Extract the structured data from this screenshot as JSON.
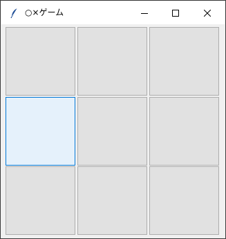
{
  "window": {
    "title": "○×ゲーム",
    "icon": "feather-icon",
    "controls": [
      "minimize-icon",
      "maximize-icon",
      "close-icon"
    ]
  },
  "board": {
    "cells": [
      {
        "row": 0,
        "col": 0,
        "value": ""
      },
      {
        "row": 0,
        "col": 1,
        "value": ""
      },
      {
        "row": 0,
        "col": 2,
        "value": ""
      },
      {
        "row": 1,
        "col": 0,
        "value": "",
        "focused": true
      },
      {
        "row": 1,
        "col": 1,
        "value": ""
      },
      {
        "row": 1,
        "col": 2,
        "value": ""
      },
      {
        "row": 2,
        "col": 0,
        "value": ""
      },
      {
        "row": 2,
        "col": 1,
        "value": ""
      },
      {
        "row": 2,
        "col": 2,
        "value": ""
      }
    ]
  },
  "colors": {
    "cell_background": "#e1e1e1",
    "focused_border": "#0078d7",
    "focused_background": "#e5f1fb"
  }
}
